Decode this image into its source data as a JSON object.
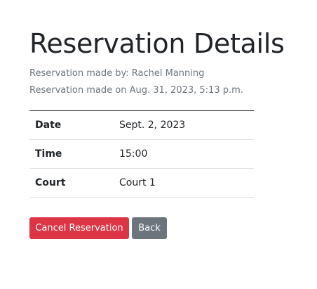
{
  "page": {
    "title": "Reservation Details",
    "made_by": "Reservation made by: Rachel Manning",
    "made_on": "Reservation made on Aug. 31, 2023, 5:13 p.m."
  },
  "details": {
    "date_label": "Date",
    "date_value": "Sept. 2, 2023",
    "time_label": "Time",
    "time_value": "15:00",
    "court_label": "Court",
    "court_value": "Court 1"
  },
  "actions": {
    "cancel_label": "Cancel Reservation",
    "back_label": "Back"
  },
  "colors": {
    "danger": "#dc3545",
    "secondary": "#6c757d",
    "text": "#212529",
    "muted": "#6c757d"
  }
}
